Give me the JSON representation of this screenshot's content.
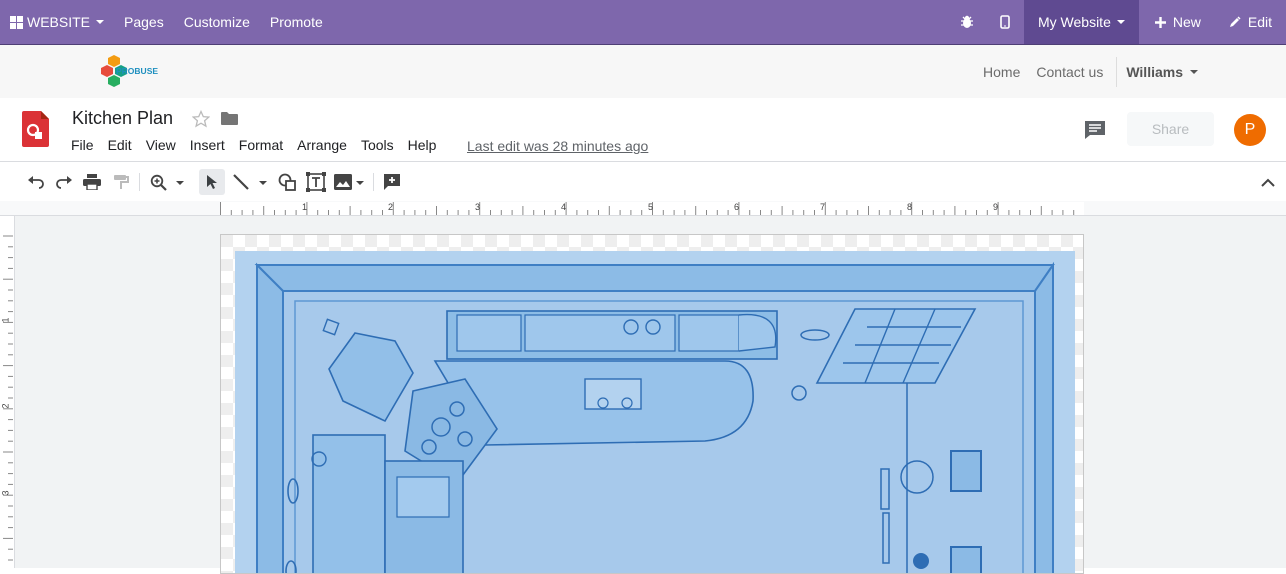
{
  "topbar": {
    "website_label": "WEBSITE",
    "pages_label": "Pages",
    "customize_label": "Customize",
    "promote_label": "Promote",
    "my_website_label": "My Website",
    "new_label": "New",
    "edit_label": "Edit"
  },
  "site_header": {
    "logo_text": "PROBUSE",
    "home_label": "Home",
    "contact_label": "Contact us",
    "user_label": "Williams"
  },
  "document": {
    "title": "Kitchen Plan",
    "menu": [
      "File",
      "Edit",
      "View",
      "Insert",
      "Format",
      "Arrange",
      "Tools",
      "Help"
    ],
    "last_edit": "Last edit was 28 minutes ago",
    "share_label": "Share",
    "avatar_letter": "P"
  },
  "ruler": {
    "h_numbers": [
      "1",
      "2",
      "3",
      "4",
      "5",
      "6",
      "7",
      "8",
      "9"
    ],
    "v_numbers": [
      "1",
      "2",
      "3"
    ]
  },
  "colors": {
    "topbar": "#7e67ac",
    "topbar_active": "#5f4a91",
    "floorplan_blue": "#4a90d9",
    "avatar": "#ef6c00"
  }
}
